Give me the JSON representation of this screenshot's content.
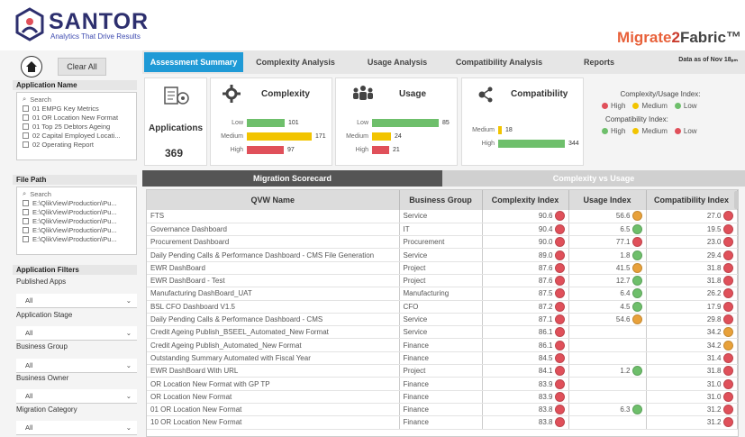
{
  "header": {
    "brand": "SANTOR",
    "tagline": "Analytics That Drive Results",
    "product_a": "Migrate",
    "product_b": "2",
    "product_c": "Fabric™"
  },
  "toolbar": {
    "clear_all": "Clear All"
  },
  "tabs": [
    {
      "label": "Assessment Summary"
    },
    {
      "label": "Complexity Analysis"
    },
    {
      "label": "Usage Analysis"
    },
    {
      "label": "Compatibility Analysis"
    },
    {
      "label": "Reports"
    }
  ],
  "date_text": "Data as of Nov 18ₚₘ",
  "left": {
    "app_name": {
      "title": "Application Name",
      "search": "Search",
      "items": [
        "01 EMPG Key Metrics",
        "01 OR Location New Format",
        "01 Top 25 Debtors Ageing",
        "02 Capital Employed Locati...",
        "02 Operating Report"
      ]
    },
    "file_path": {
      "title": "File Path",
      "search": "Search",
      "items": [
        "E:\\QlikView\\Production\\Pu...",
        "E:\\QlikView\\Production\\Pu...",
        "E:\\QlikView\\Production\\Pu...",
        "E:\\QlikView\\Production\\Pu...",
        "E:\\QlikView\\Production\\Pu..."
      ]
    },
    "filters_title": "Application Filters",
    "filters": [
      {
        "label": "Published Apps",
        "value": "All"
      },
      {
        "label": "Application Stage",
        "value": "All"
      },
      {
        "label": "Business Group",
        "value": "All"
      },
      {
        "label": "Business Owner",
        "value": "All"
      },
      {
        "label": "Migration Category",
        "value": "All"
      }
    ]
  },
  "kpi": {
    "applications_label": "Applications",
    "applications_value": "369",
    "complexity": {
      "title": "Complexity",
      "rows": [
        {
          "label": "Low",
          "value": "101",
          "fill": 0.59,
          "color": "#6ebf6b"
        },
        {
          "label": "Medium",
          "value": "171",
          "fill": 1.0,
          "color": "#f2c400"
        },
        {
          "label": "High",
          "value": "97",
          "fill": 0.57,
          "color": "#e0505a"
        }
      ]
    },
    "usage": {
      "title": "Usage",
      "rows": [
        {
          "label": "Low",
          "value": "85",
          "fill": 1.0,
          "color": "#6ebf6b"
        },
        {
          "label": "Medium",
          "value": "24",
          "fill": 0.28,
          "color": "#f2c400"
        },
        {
          "label": "High",
          "value": "21",
          "fill": 0.25,
          "color": "#e0505a"
        }
      ]
    },
    "compat": {
      "title": "Compatibility",
      "rows": [
        {
          "label": "Medium",
          "value": "18",
          "fill": 0.05,
          "color": "#f2c400"
        },
        {
          "label": "High",
          "value": "344",
          "fill": 1.0,
          "color": "#6ebf6b"
        }
      ]
    },
    "legend": {
      "cu_title": "Complexity/Usage Index:",
      "cu_items": [
        {
          "label": "High",
          "color": "#e0505a"
        },
        {
          "label": "Medium",
          "color": "#f2c400"
        },
        {
          "label": "Low",
          "color": "#6ebf6b"
        }
      ],
      "c_title": "Compatibility Index:",
      "c_items": [
        {
          "label": "High",
          "color": "#6ebf6b"
        },
        {
          "label": "Medium",
          "color": "#f2c400"
        },
        {
          "label": "Low",
          "color": "#e0505a"
        }
      ]
    }
  },
  "sections": {
    "migration_scorecard": "Migration Scorecard",
    "complexity_vs_usage": "Complexity vs Usage"
  },
  "table": {
    "headers": [
      "QVW Name",
      "Business Group",
      "Complexity Index",
      "Usage Index",
      "Compatibility Index"
    ],
    "rows": [
      [
        "FTS",
        "Service",
        "90.6",
        "red",
        "56.6",
        "orange",
        "27.0",
        "red"
      ],
      [
        "Governance Dashboard",
        "IT",
        "90.4",
        "red",
        "6.5",
        "green",
        "19.5",
        "red"
      ],
      [
        "Procurement Dashboard",
        "Procurement",
        "90.0",
        "red",
        "77.1",
        "red",
        "23.0",
        "red"
      ],
      [
        "Daily Pending Calls & Performance Dashboard - CMS File Generation",
        "Service",
        "89.0",
        "red",
        "1.8",
        "green",
        "29.4",
        "red"
      ],
      [
        "EWR DashBoard",
        "Project",
        "87.6",
        "red",
        "41.5",
        "orange",
        "31.8",
        "red"
      ],
      [
        "EWR DashBoard - Test",
        "Project",
        "87.6",
        "red",
        "12.7",
        "green",
        "31.8",
        "red"
      ],
      [
        "Manufacturing DashBoard_UAT",
        "Manufacturing",
        "87.5",
        "red",
        "6.4",
        "green",
        "26.2",
        "red"
      ],
      [
        "BSL CFO Dashboard V1.5",
        "CFO",
        "87.2",
        "red",
        "4.5",
        "green",
        "17.9",
        "red"
      ],
      [
        "Daily Pending Calls & Performance Dashboard - CMS",
        "Service",
        "87.1",
        "red",
        "54.6",
        "orange",
        "29.8",
        "red"
      ],
      [
        "Credit Ageing Publish_BSEEL_Automated_New Format",
        "Service",
        "86.1",
        "red",
        "",
        "",
        "34.2",
        "orange"
      ],
      [
        "Credit Ageing Publish_Automated_New Format",
        "Finance",
        "86.1",
        "red",
        "",
        "",
        "34.2",
        "orange"
      ],
      [
        "Outstanding Summary Automated with Fiscal Year",
        "Finance",
        "84.5",
        "red",
        "",
        "",
        "31.4",
        "red"
      ],
      [
        "EWR DashBoard With URL",
        "Project",
        "84.1",
        "red",
        "1.2",
        "green",
        "31.8",
        "red"
      ],
      [
        "OR Location New Format with GP TP",
        "Finance",
        "83.9",
        "red",
        "",
        "",
        "31.0",
        "red"
      ],
      [
        "OR Location New Format",
        "Finance",
        "83.9",
        "red",
        "",
        "",
        "31.0",
        "red"
      ],
      [
        "01 OR Location New Format",
        "Finance",
        "83.8",
        "red",
        "6.3",
        "green",
        "31.2",
        "red"
      ],
      [
        "10 OR Location New Format",
        "Finance",
        "83.8",
        "red",
        "",
        "",
        "31.2",
        "red"
      ]
    ]
  },
  "colors": {
    "red": "#e0505a",
    "orange": "#e8a13a",
    "green": "#6ebf6b",
    "accent": "#1f9ad6"
  }
}
